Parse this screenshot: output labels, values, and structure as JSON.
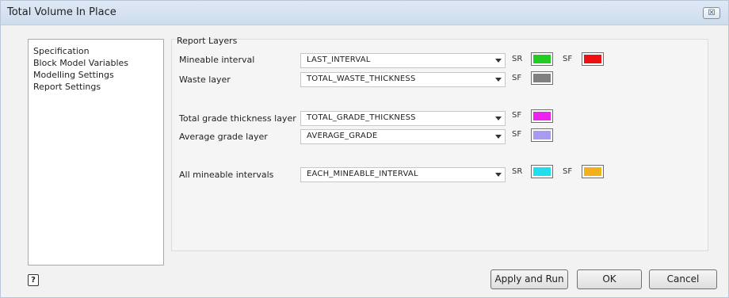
{
  "window": {
    "title": "Total Volume In Place",
    "close_glyph": "☒"
  },
  "nav": {
    "items": [
      {
        "label": "Specification"
      },
      {
        "label": "Block Model Variables"
      },
      {
        "label": "Modelling Settings"
      },
      {
        "label": "Report Settings"
      }
    ]
  },
  "report_layers": {
    "title": "Report Layers",
    "rows": [
      {
        "label": "Mineable interval",
        "value": "LAST_INTERVAL",
        "colors": [
          {
            "tag": "SR",
            "color": "#22cc22"
          },
          {
            "tag": "SF",
            "color": "#ee1111"
          }
        ]
      },
      {
        "label": "Waste layer",
        "value": "TOTAL_WASTE_THICKNESS",
        "colors": [
          {
            "tag": "SF",
            "color": "#808080"
          }
        ]
      },
      {
        "label": "Total grade thickness layer",
        "value": "TOTAL_GRADE_THICKNESS",
        "colors": [
          {
            "tag": "SF",
            "color": "#ee22ee"
          }
        ]
      },
      {
        "label": "Average grade layer",
        "value": "AVERAGE_GRADE",
        "colors": [
          {
            "tag": "SF",
            "color": "#a99af0"
          }
        ]
      },
      {
        "label": "All mineable intervals",
        "value": "EACH_MINEABLE_INTERVAL",
        "colors": [
          {
            "tag": "SR",
            "color": "#22ddee"
          },
          {
            "tag": "SF",
            "color": "#f2b11a"
          }
        ]
      }
    ]
  },
  "footer": {
    "help_glyph": "?",
    "apply_run_label": "Apply and Run",
    "ok_label": "OK",
    "cancel_label": "Cancel"
  }
}
